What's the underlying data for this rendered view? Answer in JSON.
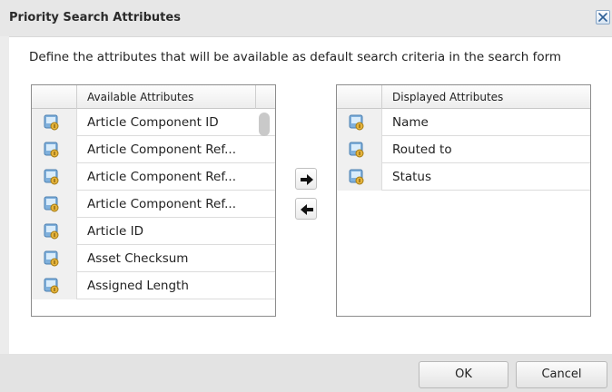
{
  "dialog": {
    "title": "Priority Search Attributes",
    "instruction": "Define the attributes that will be available as default search criteria in the search form"
  },
  "available": {
    "header": "Available Attributes",
    "items": [
      {
        "label": "Article Component ID"
      },
      {
        "label": "Article Component Ref..."
      },
      {
        "label": "Article Component Ref..."
      },
      {
        "label": "Article Component Ref..."
      },
      {
        "label": "Article ID"
      },
      {
        "label": "Asset Checksum"
      },
      {
        "label": "Assigned Length"
      }
    ]
  },
  "displayed": {
    "header": "Displayed Attributes",
    "items": [
      {
        "label": "Name"
      },
      {
        "label": "Routed to"
      },
      {
        "label": "Status"
      }
    ]
  },
  "buttons": {
    "ok": "OK",
    "cancel": "Cancel"
  },
  "icons": {
    "close": "close-icon",
    "attribute": "attribute-icon",
    "move_right": "arrow-right-icon",
    "move_left": "arrow-left-icon"
  }
}
